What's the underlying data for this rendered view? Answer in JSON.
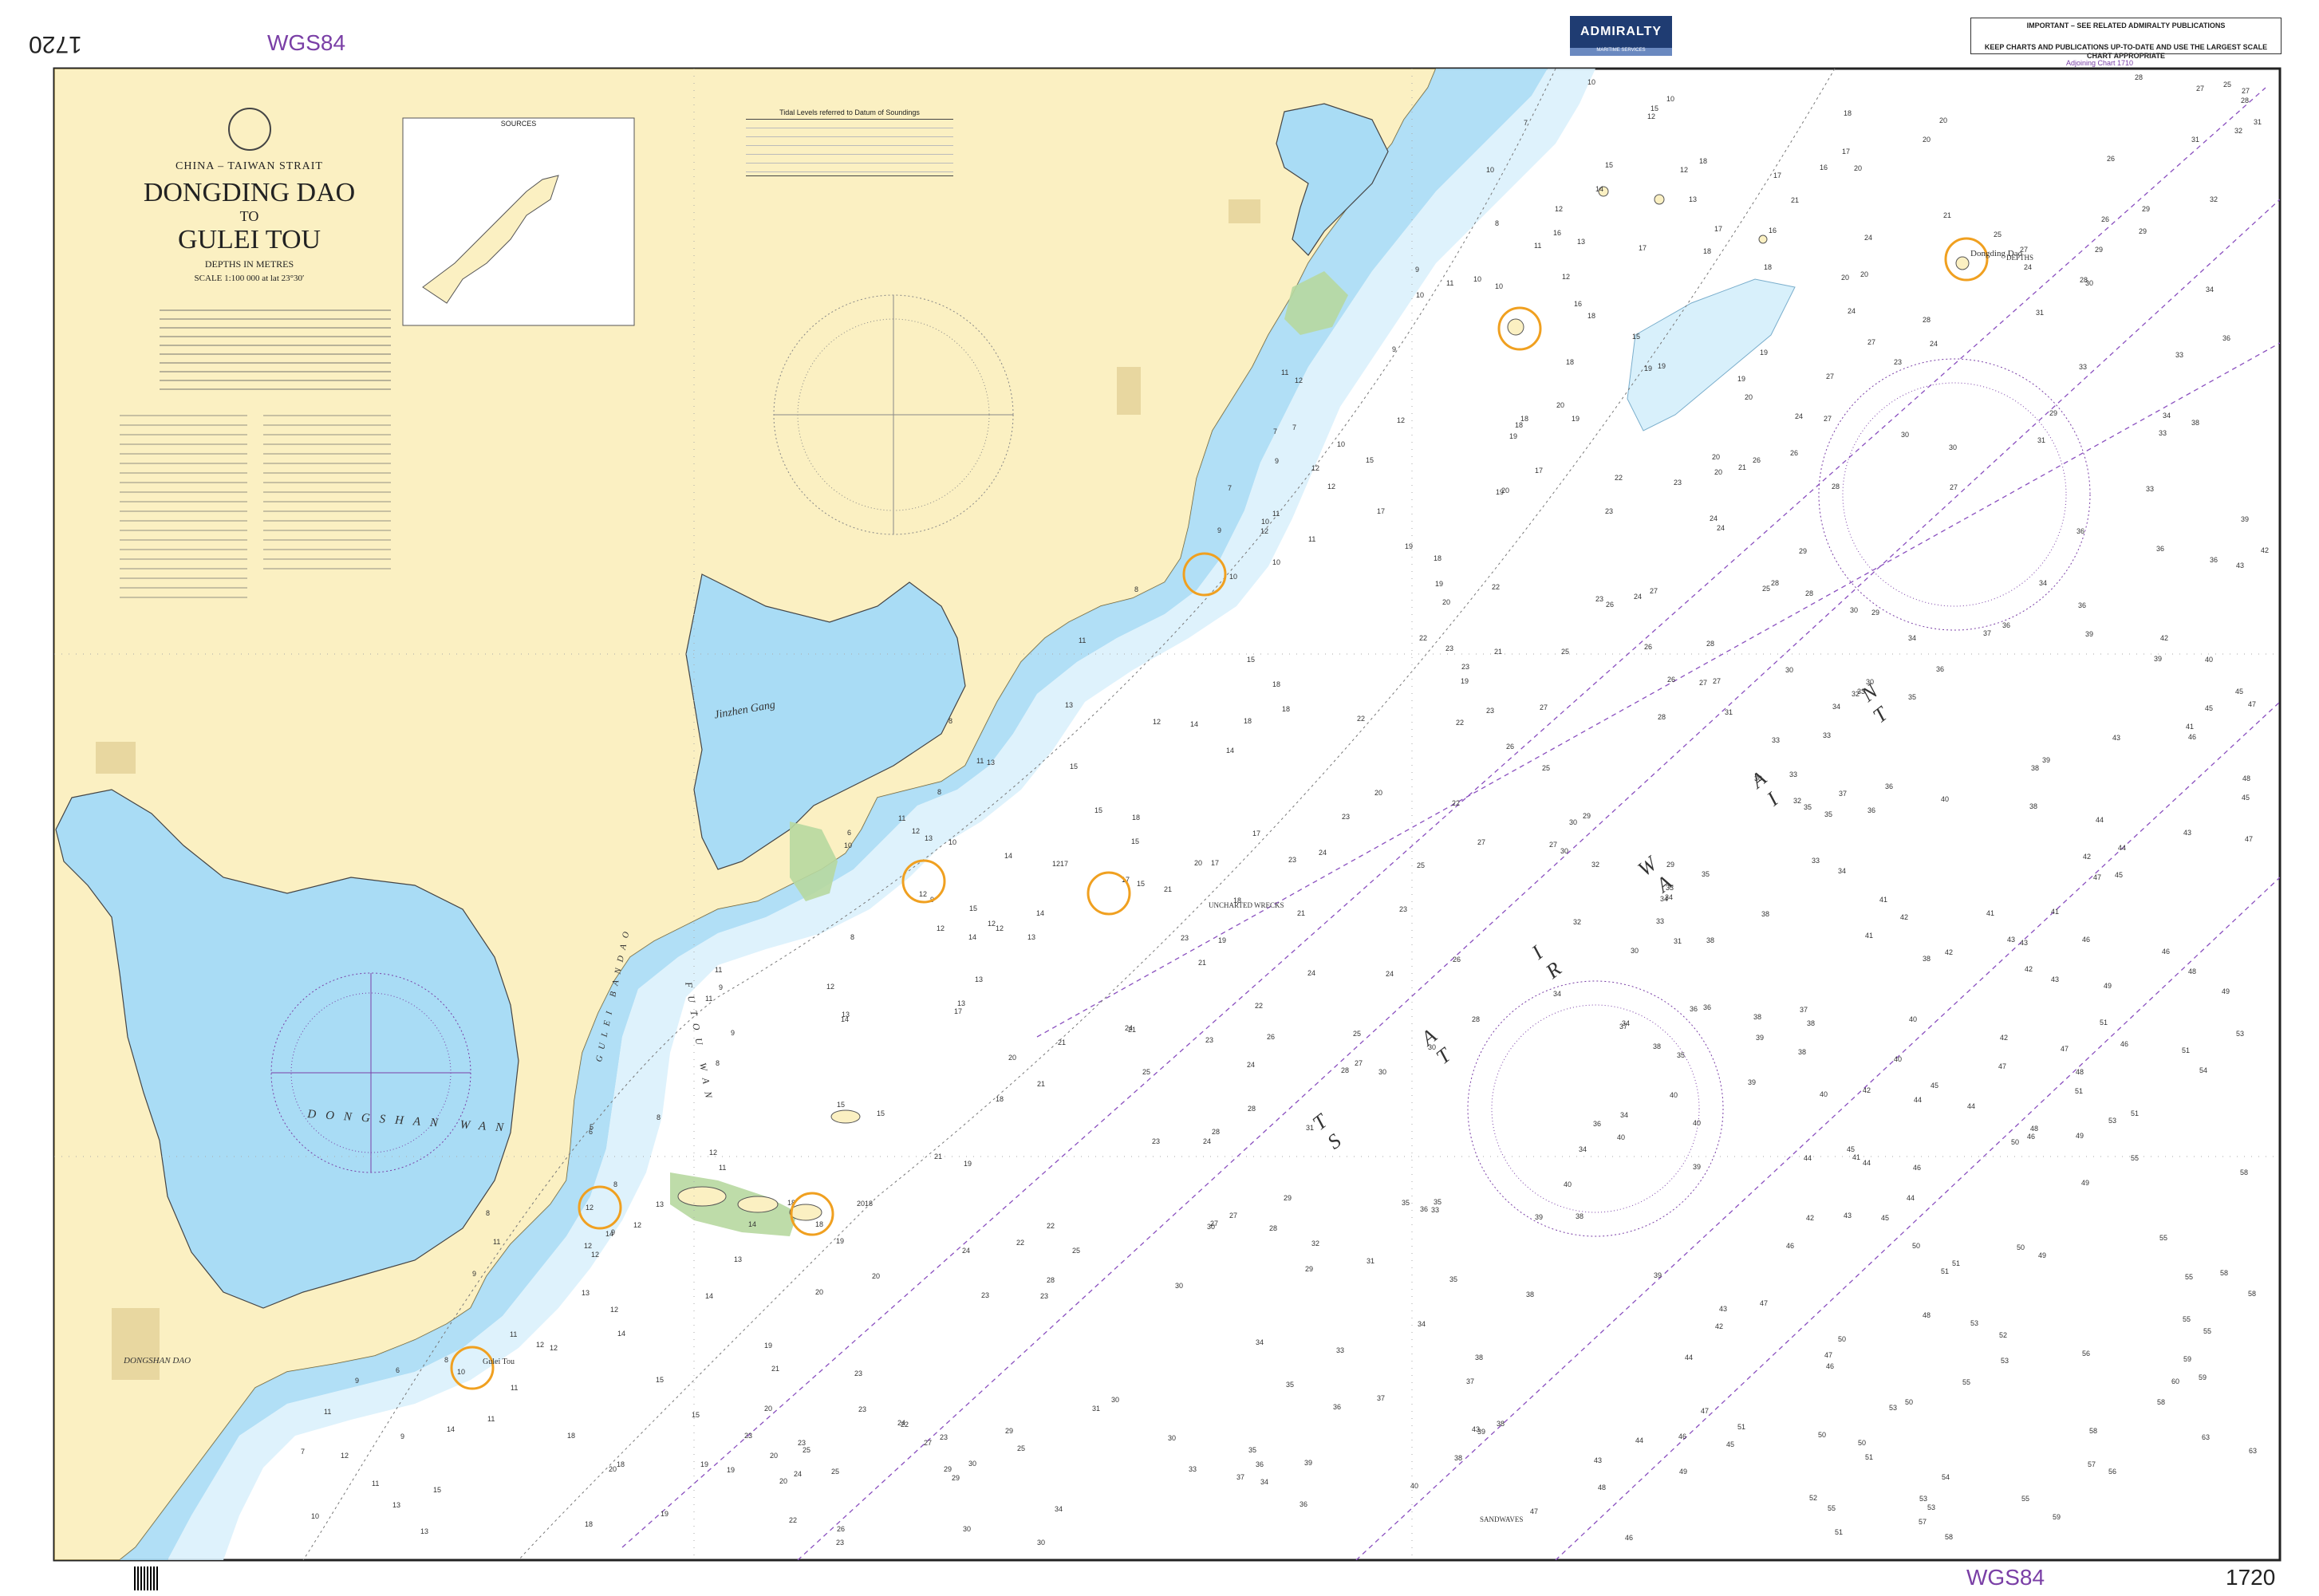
{
  "chart": {
    "number": "1720",
    "datum": "WGS84",
    "country": "CHINA – TAIWAN STRAIT",
    "title_line1": "DONGDING DAO",
    "title_to": "TO",
    "title_line2": "GULEI TOU",
    "depths": "DEPTHS IN METRES",
    "scale": "SCALE 1:100 000 at lat 23°30′",
    "adjoining": "Adjoining Chart 1710",
    "publisher": "ADMIRALTY",
    "publisher_sub": "MARITIME SERVICES",
    "important_title": "IMPORTANT – SEE RELATED ADMIRALTY PUBLICATIONS",
    "important_footer": "KEEP CHARTS AND PUBLICATIONS UP-TO-DATE AND USE THE LARGEST SCALE CHART APPROPRIATE",
    "sources_title": "SOURCES",
    "tide_title": "Tidal Levels referred to Datum of Soundings"
  },
  "place_names": {
    "jinzhen_gang": "Jinzhen Gang",
    "dongshan_wan": "DONGSHAN WAN",
    "dongshan_dao": "DONGSHAN DAO",
    "taiwan_strait": "TAIWAN STRAIT",
    "dongding_dao": "Dongding Dao",
    "gulei_tou": "Gulei Tou",
    "futou_wan": "FUTOU WAN",
    "gulei_bandao": "GULEI BANDAO",
    "unchartered_wrecks": "UNCHARTED WRECKS",
    "sandwaves": "SANDWAVES",
    "depths": "DEPTHS"
  },
  "colors": {
    "land": "#fbf0c2",
    "shallow": "#a9dcf5",
    "mid": "#d8f0fb",
    "sea": "#ffffff",
    "drying": "#b7d8a0",
    "magenta": "#8a4fbf",
    "highlight": "#f0a020",
    "border": "#222222"
  },
  "highlight_markers": [
    {
      "name": "marker-dongding-dao"
    },
    {
      "name": "marker-north-islet"
    },
    {
      "name": "marker-coast-north"
    },
    {
      "name": "marker-jinzhen-east"
    },
    {
      "name": "marker-offshore-mid"
    },
    {
      "name": "marker-futou"
    },
    {
      "name": "marker-gulei-west"
    },
    {
      "name": "marker-gulei-tou"
    }
  ]
}
